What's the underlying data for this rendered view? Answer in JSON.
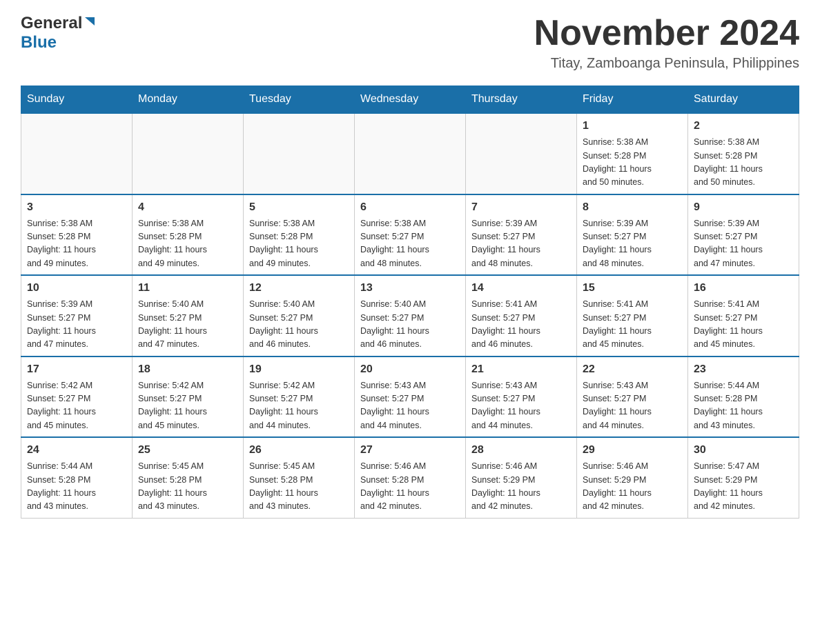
{
  "header": {
    "logo_general": "General",
    "logo_blue": "Blue",
    "month_year": "November 2024",
    "location": "Titay, Zamboanga Peninsula, Philippines"
  },
  "days_of_week": [
    "Sunday",
    "Monday",
    "Tuesday",
    "Wednesday",
    "Thursday",
    "Friday",
    "Saturday"
  ],
  "weeks": [
    {
      "days": [
        {
          "num": "",
          "info": ""
        },
        {
          "num": "",
          "info": ""
        },
        {
          "num": "",
          "info": ""
        },
        {
          "num": "",
          "info": ""
        },
        {
          "num": "",
          "info": ""
        },
        {
          "num": "1",
          "info": "Sunrise: 5:38 AM\nSunset: 5:28 PM\nDaylight: 11 hours\nand 50 minutes."
        },
        {
          "num": "2",
          "info": "Sunrise: 5:38 AM\nSunset: 5:28 PM\nDaylight: 11 hours\nand 50 minutes."
        }
      ]
    },
    {
      "days": [
        {
          "num": "3",
          "info": "Sunrise: 5:38 AM\nSunset: 5:28 PM\nDaylight: 11 hours\nand 49 minutes."
        },
        {
          "num": "4",
          "info": "Sunrise: 5:38 AM\nSunset: 5:28 PM\nDaylight: 11 hours\nand 49 minutes."
        },
        {
          "num": "5",
          "info": "Sunrise: 5:38 AM\nSunset: 5:28 PM\nDaylight: 11 hours\nand 49 minutes."
        },
        {
          "num": "6",
          "info": "Sunrise: 5:38 AM\nSunset: 5:27 PM\nDaylight: 11 hours\nand 48 minutes."
        },
        {
          "num": "7",
          "info": "Sunrise: 5:39 AM\nSunset: 5:27 PM\nDaylight: 11 hours\nand 48 minutes."
        },
        {
          "num": "8",
          "info": "Sunrise: 5:39 AM\nSunset: 5:27 PM\nDaylight: 11 hours\nand 48 minutes."
        },
        {
          "num": "9",
          "info": "Sunrise: 5:39 AM\nSunset: 5:27 PM\nDaylight: 11 hours\nand 47 minutes."
        }
      ]
    },
    {
      "days": [
        {
          "num": "10",
          "info": "Sunrise: 5:39 AM\nSunset: 5:27 PM\nDaylight: 11 hours\nand 47 minutes."
        },
        {
          "num": "11",
          "info": "Sunrise: 5:40 AM\nSunset: 5:27 PM\nDaylight: 11 hours\nand 47 minutes."
        },
        {
          "num": "12",
          "info": "Sunrise: 5:40 AM\nSunset: 5:27 PM\nDaylight: 11 hours\nand 46 minutes."
        },
        {
          "num": "13",
          "info": "Sunrise: 5:40 AM\nSunset: 5:27 PM\nDaylight: 11 hours\nand 46 minutes."
        },
        {
          "num": "14",
          "info": "Sunrise: 5:41 AM\nSunset: 5:27 PM\nDaylight: 11 hours\nand 46 minutes."
        },
        {
          "num": "15",
          "info": "Sunrise: 5:41 AM\nSunset: 5:27 PM\nDaylight: 11 hours\nand 45 minutes."
        },
        {
          "num": "16",
          "info": "Sunrise: 5:41 AM\nSunset: 5:27 PM\nDaylight: 11 hours\nand 45 minutes."
        }
      ]
    },
    {
      "days": [
        {
          "num": "17",
          "info": "Sunrise: 5:42 AM\nSunset: 5:27 PM\nDaylight: 11 hours\nand 45 minutes."
        },
        {
          "num": "18",
          "info": "Sunrise: 5:42 AM\nSunset: 5:27 PM\nDaylight: 11 hours\nand 45 minutes."
        },
        {
          "num": "19",
          "info": "Sunrise: 5:42 AM\nSunset: 5:27 PM\nDaylight: 11 hours\nand 44 minutes."
        },
        {
          "num": "20",
          "info": "Sunrise: 5:43 AM\nSunset: 5:27 PM\nDaylight: 11 hours\nand 44 minutes."
        },
        {
          "num": "21",
          "info": "Sunrise: 5:43 AM\nSunset: 5:27 PM\nDaylight: 11 hours\nand 44 minutes."
        },
        {
          "num": "22",
          "info": "Sunrise: 5:43 AM\nSunset: 5:27 PM\nDaylight: 11 hours\nand 44 minutes."
        },
        {
          "num": "23",
          "info": "Sunrise: 5:44 AM\nSunset: 5:28 PM\nDaylight: 11 hours\nand 43 minutes."
        }
      ]
    },
    {
      "days": [
        {
          "num": "24",
          "info": "Sunrise: 5:44 AM\nSunset: 5:28 PM\nDaylight: 11 hours\nand 43 minutes."
        },
        {
          "num": "25",
          "info": "Sunrise: 5:45 AM\nSunset: 5:28 PM\nDaylight: 11 hours\nand 43 minutes."
        },
        {
          "num": "26",
          "info": "Sunrise: 5:45 AM\nSunset: 5:28 PM\nDaylight: 11 hours\nand 43 minutes."
        },
        {
          "num": "27",
          "info": "Sunrise: 5:46 AM\nSunset: 5:28 PM\nDaylight: 11 hours\nand 42 minutes."
        },
        {
          "num": "28",
          "info": "Sunrise: 5:46 AM\nSunset: 5:29 PM\nDaylight: 11 hours\nand 42 minutes."
        },
        {
          "num": "29",
          "info": "Sunrise: 5:46 AM\nSunset: 5:29 PM\nDaylight: 11 hours\nand 42 minutes."
        },
        {
          "num": "30",
          "info": "Sunrise: 5:47 AM\nSunset: 5:29 PM\nDaylight: 11 hours\nand 42 minutes."
        }
      ]
    }
  ]
}
